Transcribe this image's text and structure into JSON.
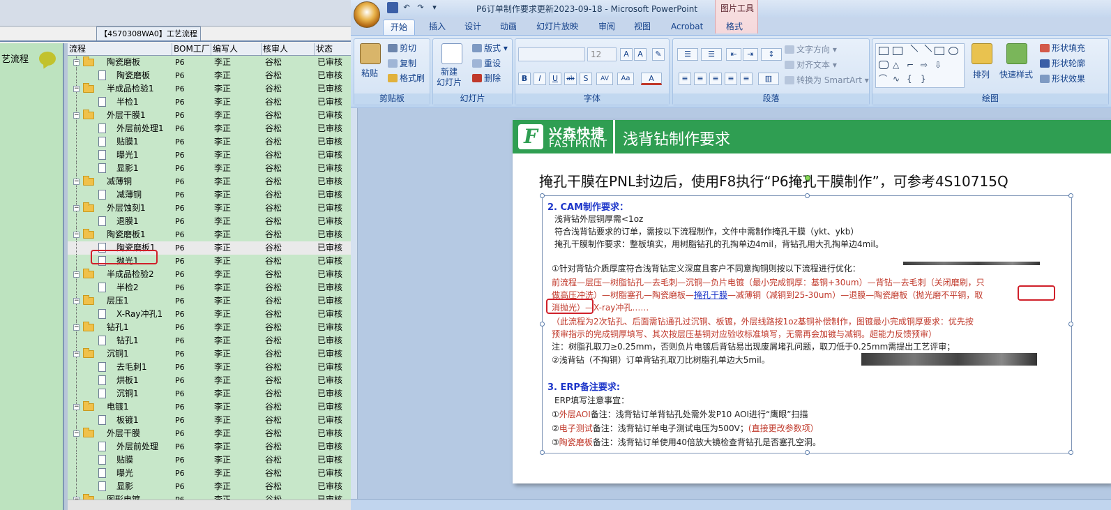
{
  "left_app": {
    "workflow_tab": "【4S70308WA0】工艺流程",
    "left_pane_title": "艺流程",
    "columns": [
      "流程",
      "BOM工厂",
      "编写人",
      "核审人",
      "状态"
    ],
    "rows": [
      {
        "level": 1,
        "name": "陶瓷磨板",
        "bom": "P6",
        "author": "李正",
        "reviewer": "谷松",
        "status": "已审核"
      },
      {
        "level": 2,
        "name": "陶瓷磨板",
        "bom": "P6",
        "author": "李正",
        "reviewer": "谷松",
        "status": "已审核"
      },
      {
        "level": 1,
        "name": "半成品检验1",
        "bom": "P6",
        "author": "李正",
        "reviewer": "谷松",
        "status": "已审核"
      },
      {
        "level": 2,
        "name": "半检1",
        "bom": "P6",
        "author": "李正",
        "reviewer": "谷松",
        "status": "已审核"
      },
      {
        "level": 1,
        "name": "外层干膜1",
        "bom": "P6",
        "author": "李正",
        "reviewer": "谷松",
        "status": "已审核"
      },
      {
        "level": 2,
        "name": "外层前处理1",
        "bom": "P6",
        "author": "李正",
        "reviewer": "谷松",
        "status": "已审核"
      },
      {
        "level": 2,
        "name": "贴膜1",
        "bom": "P6",
        "author": "李正",
        "reviewer": "谷松",
        "status": "已审核"
      },
      {
        "level": 2,
        "name": "曝光1",
        "bom": "P6",
        "author": "李正",
        "reviewer": "谷松",
        "status": "已审核"
      },
      {
        "level": 2,
        "name": "显影1",
        "bom": "P6",
        "author": "李正",
        "reviewer": "谷松",
        "status": "已审核"
      },
      {
        "level": 1,
        "name": "减薄铜",
        "bom": "P6",
        "author": "李正",
        "reviewer": "谷松",
        "status": "已审核"
      },
      {
        "level": 2,
        "name": "减薄铜",
        "bom": "P6",
        "author": "李正",
        "reviewer": "谷松",
        "status": "已审核"
      },
      {
        "level": 1,
        "name": "外层蚀刻1",
        "bom": "P6",
        "author": "李正",
        "reviewer": "谷松",
        "status": "已审核"
      },
      {
        "level": 2,
        "name": "退膜1",
        "bom": "P6",
        "author": "李正",
        "reviewer": "谷松",
        "status": "已审核"
      },
      {
        "level": 1,
        "name": "陶瓷磨板1",
        "bom": "P6",
        "author": "李正",
        "reviewer": "谷松",
        "status": "已审核"
      },
      {
        "level": 2,
        "name": "陶瓷磨板1",
        "bom": "P6",
        "author": "李正",
        "reviewer": "谷松",
        "status": "已审核",
        "selected": true
      },
      {
        "level": 2,
        "name": "抛光1",
        "bom": "P6",
        "author": "李正",
        "reviewer": "谷松",
        "status": "已审核"
      },
      {
        "level": 1,
        "name": "半成品检验2",
        "bom": "P6",
        "author": "李正",
        "reviewer": "谷松",
        "status": "已审核"
      },
      {
        "level": 2,
        "name": "半检2",
        "bom": "P6",
        "author": "李正",
        "reviewer": "谷松",
        "status": "已审核"
      },
      {
        "level": 1,
        "name": "层压1",
        "bom": "P6",
        "author": "李正",
        "reviewer": "谷松",
        "status": "已审核"
      },
      {
        "level": 2,
        "name": "X-Ray冲孔1",
        "bom": "P6",
        "author": "李正",
        "reviewer": "谷松",
        "status": "已审核"
      },
      {
        "level": 1,
        "name": "钻孔1",
        "bom": "P6",
        "author": "李正",
        "reviewer": "谷松",
        "status": "已审核"
      },
      {
        "level": 2,
        "name": "钻孔1",
        "bom": "P6",
        "author": "李正",
        "reviewer": "谷松",
        "status": "已审核"
      },
      {
        "level": 1,
        "name": "沉铜1",
        "bom": "P6",
        "author": "李正",
        "reviewer": "谷松",
        "status": "已审核"
      },
      {
        "level": 2,
        "name": "去毛刺1",
        "bom": "P6",
        "author": "李正",
        "reviewer": "谷松",
        "status": "已审核"
      },
      {
        "level": 2,
        "name": "烘板1",
        "bom": "P6",
        "author": "李正",
        "reviewer": "谷松",
        "status": "已审核"
      },
      {
        "level": 2,
        "name": "沉铜1",
        "bom": "P6",
        "author": "李正",
        "reviewer": "谷松",
        "status": "已审核"
      },
      {
        "level": 1,
        "name": "电镀1",
        "bom": "P6",
        "author": "李正",
        "reviewer": "谷松",
        "status": "已审核"
      },
      {
        "level": 2,
        "name": "板镀1",
        "bom": "P6",
        "author": "李正",
        "reviewer": "谷松",
        "status": "已审核"
      },
      {
        "level": 1,
        "name": "外层干膜",
        "bom": "P6",
        "author": "李正",
        "reviewer": "谷松",
        "status": "已审核"
      },
      {
        "level": 2,
        "name": "外层前处理",
        "bom": "P6",
        "author": "李正",
        "reviewer": "谷松",
        "status": "已审核"
      },
      {
        "level": 2,
        "name": "贴膜",
        "bom": "P6",
        "author": "李正",
        "reviewer": "谷松",
        "status": "已审核"
      },
      {
        "level": 2,
        "name": "曝光",
        "bom": "P6",
        "author": "李正",
        "reviewer": "谷松",
        "status": "已审核"
      },
      {
        "level": 2,
        "name": "显影",
        "bom": "P6",
        "author": "李正",
        "reviewer": "谷松",
        "status": "已审核"
      },
      {
        "level": 1,
        "name": "图形电镀",
        "bom": "P6",
        "author": "李正",
        "reviewer": "谷松",
        "status": "已审核"
      }
    ]
  },
  "ppt": {
    "window_title": "P6订单制作要求更新2023-09-18 - Microsoft PowerPoint",
    "context_tab_group": "图片工具",
    "tabs": [
      "开始",
      "插入",
      "设计",
      "动画",
      "幻灯片放映",
      "审阅",
      "视图",
      "Acrobat",
      "格式"
    ],
    "ribbon": {
      "clipboard": {
        "paste": "粘贴",
        "cut": "剪切",
        "copy": "复制",
        "format_painter": "格式刷",
        "label": "剪贴板"
      },
      "slides": {
        "new_slide": "新建\n幻灯片",
        "layout": "版式",
        "reset": "重设",
        "delete": "删除",
        "label": "幻灯片"
      },
      "font": {
        "size": "12",
        "label": "字体"
      },
      "paragraph": {
        "text_direction": "文字方向",
        "align_text": "对齐文本",
        "smartart": "转换为 SmartArt",
        "label": "段落"
      },
      "drawing": {
        "arrange": "排列",
        "quick_styles": "快速样式",
        "shape_fill": "形状填充",
        "shape_outline": "形状轮廓",
        "shape_effects": "形状效果",
        "label": "绘图"
      }
    },
    "slide": {
      "logo_letter": "F",
      "logo_cn": "兴森快捷",
      "logo_en": "FASTPRINT",
      "banner_title": "浅背钻制作要求",
      "headline": "掩孔干膜在PNL封边后，使用F8执行“P6掩孔干膜制作”，可参考4S10715Q",
      "cam_heading": "2. CAM制作要求：",
      "cam_1": "浅背钻外层铜厚需<1oz",
      "cam_2": "符合浅背钻要求的订单，需按以下流程制作，文件中需制作掩孔干膜（ykt、ykb）",
      "cam_3": "掩孔干膜制作要求：整板填实，用树脂钻孔的孔掏单边4mil，背钻孔用大孔掏单边4mil。",
      "item_1": "①针对背钻介质厚度符合浅背钻定义深度且客户不同意掏铜则按以下流程进行优化：",
      "flow_1": "前流程—层压—树脂钻孔—去毛刺—沉铜—负片电镀（最小完成铜厚：基铜+30um）—背钻—去毛刺（关闭磨刷，只",
      "flow_2a": "做高压冲洗）—树脂塞孔—陶瓷磨板—",
      "flow_2b": "掩孔干膜",
      "flow_2c": "—减薄铜（减铜到25-30um）—退膜—陶瓷磨板（抛光磨不平铜，",
      "flow_2d": "取",
      "flow_3a": "消抛光）",
      "flow_3b": "—X-ray冲孔……",
      "note_1": "（此流程为2次钻孔、后面需钻通孔过沉铜、板镀，外层线路按1oz基铜补偿制作，图镀最小完成铜厚要求：优先按",
      "note_2": "预审指示的完成铜厚填写、其次按层压基铜对应验收标准填写，无需再会加镀与减铜。超能力反馈预审）",
      "note_3": "注：树脂孔取刀≥0.25mm，否则负片电镀后背钻易出现废屑堵孔问题，取刀低于0.25mm需提出工艺评审；",
      "item_2": "②浅背钻（不掏铜）订单背钻孔取刀比树脂孔单边大5mil。",
      "erp_heading": "3. ERP备注要求:",
      "erp_0": "ERP填写注意事宜：",
      "erp_1a": "①",
      "erp_1b": "外层AOI",
      "erp_1c": "备注：浅背钻订单背钻孔处需外发P10 AOI进行“鹰眼”扫描",
      "erp_2a": "②",
      "erp_2b": "电子测试",
      "erp_2c": "备注：浅背钻订单电子测试电压为500V；",
      "erp_2d": "(直接更改参数项）",
      "erp_3a": "③",
      "erp_3b": "陶瓷磨板",
      "erp_3c": "备注：浅背钻订单使用40倍放大镜检查背钻孔是否塞孔空洞。"
    }
  }
}
